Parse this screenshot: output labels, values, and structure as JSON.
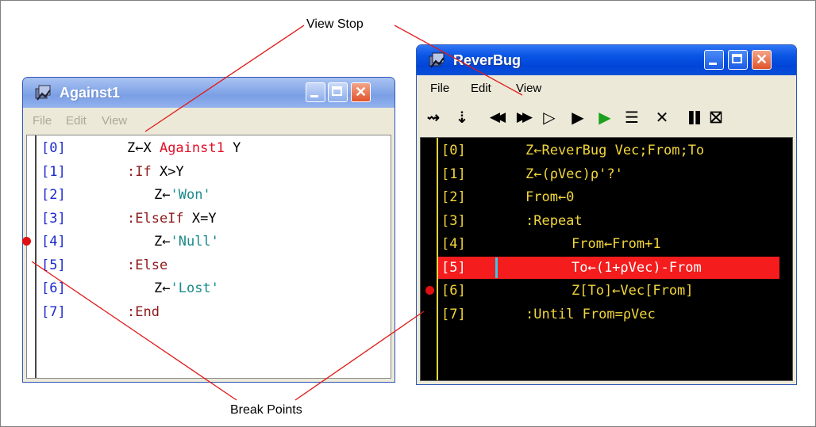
{
  "annotations": {
    "view_stop": "View Stop",
    "break_points": "Break Points"
  },
  "window1": {
    "title": "Against1",
    "menus": [
      "File",
      "Edit",
      "View"
    ],
    "lines": [
      {
        "num": "[0]",
        "parts": [
          {
            "t": "Z←X ",
            "c": "#000"
          },
          {
            "t": "Against1",
            "c": "#e0102a"
          },
          {
            "t": " Y",
            "c": "#000"
          }
        ],
        "indent": 0
      },
      {
        "num": "[1]",
        "parts": [
          {
            "t": ":If",
            "c": "#8b1a1a"
          },
          {
            "t": " X>Y",
            "c": "#000"
          }
        ],
        "indent": 0
      },
      {
        "num": "[2]",
        "parts": [
          {
            "t": "Z←",
            "c": "#000"
          },
          {
            "t": "'Won'",
            "c": "#1a8a8a"
          }
        ],
        "indent": 1
      },
      {
        "num": "[3]",
        "parts": [
          {
            "t": ":ElseIf",
            "c": "#8b1a1a"
          },
          {
            "t": " X=Y",
            "c": "#000"
          }
        ],
        "indent": 0
      },
      {
        "num": "[4]",
        "parts": [
          {
            "t": "Z←",
            "c": "#000"
          },
          {
            "t": "'Null'",
            "c": "#1a8a8a"
          }
        ],
        "indent": 1
      },
      {
        "num": "[5]",
        "parts": [
          {
            "t": ":Else",
            "c": "#8b1a1a"
          }
        ],
        "indent": 0
      },
      {
        "num": "[6]",
        "parts": [
          {
            "t": "Z←",
            "c": "#000"
          },
          {
            "t": "'Lost'",
            "c": "#1a8a8a"
          }
        ],
        "indent": 1
      },
      {
        "num": "[7]",
        "parts": [
          {
            "t": ":End",
            "c": "#8b1a1a"
          }
        ],
        "indent": 0
      }
    ]
  },
  "window2": {
    "title": "ReverBug",
    "menus": [
      "File",
      "Edit",
      "View"
    ],
    "toolbar": [
      {
        "icon": "trace-into-icon",
        "glyph": "⇝"
      },
      {
        "icon": "step-over-icon",
        "glyph": "⇣"
      },
      {
        "icon": "step-back-icon",
        "glyph": "◀◀"
      },
      {
        "icon": "step-forward-icon",
        "glyph": "▶▶"
      },
      {
        "icon": "continue-outline-icon",
        "glyph": "▷"
      },
      {
        "icon": "run-icon",
        "glyph": "▶"
      },
      {
        "icon": "run-green-icon",
        "glyph": "▶"
      },
      {
        "icon": "edit-lines-icon",
        "glyph": "☰"
      },
      {
        "icon": "clear-icon",
        "glyph": "✕"
      },
      {
        "icon": "pause-icon",
        "glyph": "❚❚"
      },
      {
        "icon": "stop-debug-icon",
        "glyph": "⛝"
      }
    ],
    "lines": [
      {
        "num": "[0]",
        "text": "Z←ReverBug Vec;From;To",
        "indent": 0
      },
      {
        "num": "[1]",
        "text": "Z←(⍴Vec)⍴'?'",
        "indent": 0
      },
      {
        "num": "[2]",
        "text": "From←0",
        "indent": 0
      },
      {
        "num": "[3]",
        "text": ":Repeat",
        "indent": 0
      },
      {
        "num": "[4]",
        "text": "From←From+1",
        "indent": 1
      },
      {
        "num": "[5]",
        "text": "To←(1+⍴Vec)-From",
        "indent": 1
      },
      {
        "num": "[6]",
        "text": "Z[To]←Vec[From]",
        "indent": 1
      },
      {
        "num": "[7]",
        "text": ":Until From=⍴Vec",
        "indent": 0
      }
    ],
    "highlighted_line": "[5]",
    "breakpoint_line": "[6]"
  },
  "colors": {
    "line_number_blue": "#1a2acd",
    "code_yellow": "#f2d63a",
    "highlight_red": "#f41c1c",
    "breakpoint_red": "#e01010"
  }
}
